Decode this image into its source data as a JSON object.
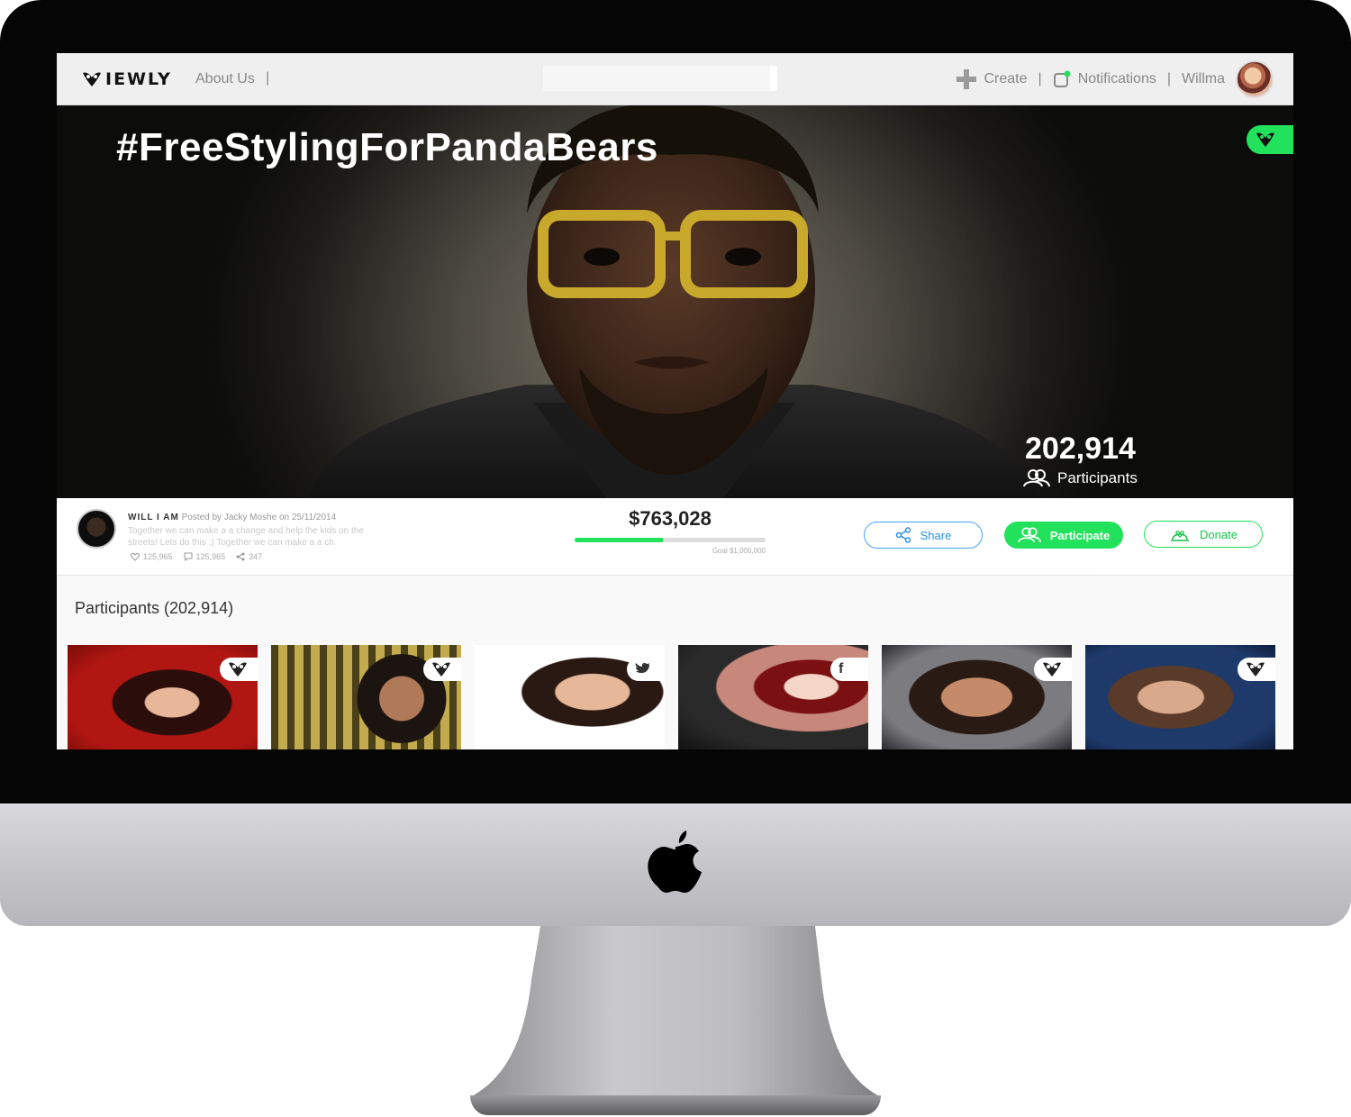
{
  "header": {
    "logo_text": "IEWLY",
    "about_label": "About Us",
    "separator": "|",
    "create_label": "Create",
    "notifications_label": "Notifications",
    "user_name": "Willma"
  },
  "hero": {
    "title": "#FreeStylingForPandaBears",
    "participant_count": "202,914",
    "participants_label": "Participants"
  },
  "post": {
    "author_name": "WILL I AM",
    "posted_by": "Posted by Jacky Moshe on 25/11/2014",
    "description": "Together we can make a a change and help the kids on the streets! Lets do this :) Together we can make a a ch",
    "likes": "125,965",
    "comments": "125,965",
    "shares": "347"
  },
  "funding": {
    "amount": "$763,028",
    "goal_text": "Goal $1,000,000",
    "progress_fraction": 0.46
  },
  "actions": {
    "share_label": "Share",
    "participate_label": "Participate",
    "donate_label": "Donate"
  },
  "participants": {
    "title": "Participants (202,914)",
    "thumbnails": [
      {
        "badge": "viewly-icon"
      },
      {
        "badge": "viewly-icon"
      },
      {
        "badge": "twitter-icon"
      },
      {
        "badge": "facebook-icon",
        "badge_text": "f"
      },
      {
        "badge": "viewly-icon"
      },
      {
        "badge": "viewly-icon"
      }
    ]
  },
  "colors": {
    "accent_green": "#22e25b",
    "share_blue": "#48a3ff",
    "bezel": "#050505",
    "chin_silver": "#c3c3c7"
  }
}
